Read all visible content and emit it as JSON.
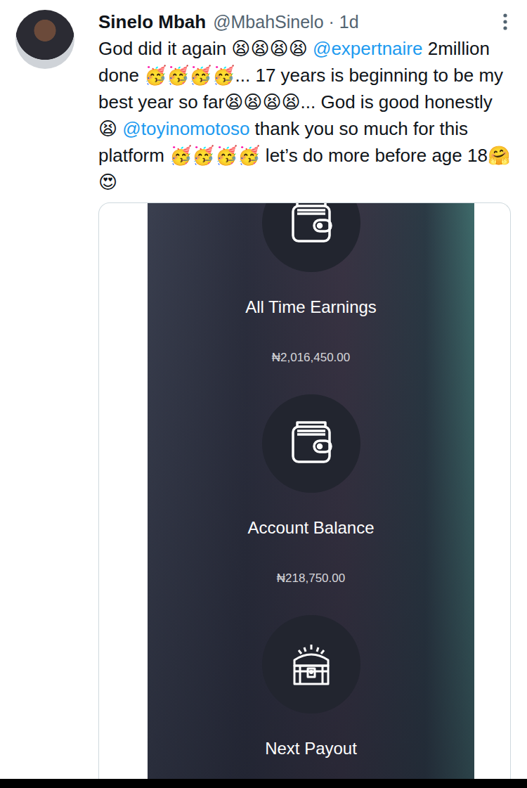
{
  "author": {
    "name": "Sinelo Mbah",
    "meta": "@MbahSinelo · 1d"
  },
  "tweet": {
    "segments": [
      {
        "kind": "text",
        "text": "God did it again 😫😫😫😫 "
      },
      {
        "kind": "mention",
        "text": "@expertnaire"
      },
      {
        "kind": "text",
        "text": " 2million done 🥳🥳🥳🥳... 17 years is beginning to be my best year so far😫😫😫😫... God is good honestly😫 "
      },
      {
        "kind": "mention",
        "text": "@toyinomotoso"
      },
      {
        "kind": "text",
        "text": " thank you so much for this platform 🥳🥳🥳🥳 let’s do more before age 18🤗😍"
      }
    ]
  },
  "media": {
    "items": [
      {
        "kind": "wallet",
        "label": "All Time Earnings",
        "value": "₦2,016,450.00"
      },
      {
        "kind": "wallet",
        "label": "Account Balance",
        "value": "₦218,750.00"
      },
      {
        "kind": "chest",
        "label": "Next Payout"
      }
    ]
  }
}
